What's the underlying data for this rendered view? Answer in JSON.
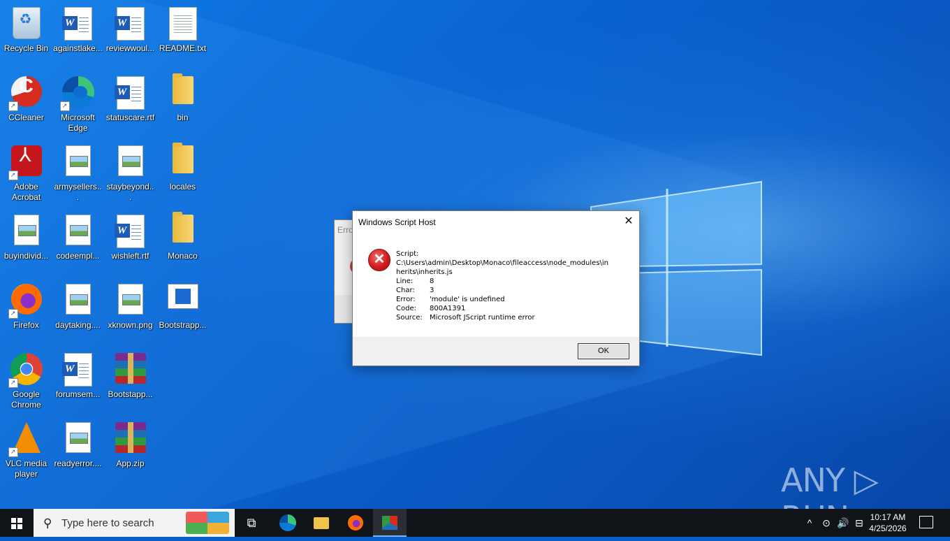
{
  "desktop": {
    "icons": [
      {
        "label": "Recycle Bin",
        "type": "recycle",
        "shortcut": false
      },
      {
        "label": "againstlake...",
        "type": "word",
        "shortcut": false
      },
      {
        "label": "reviewwoul...",
        "type": "word",
        "shortcut": false
      },
      {
        "label": "README.txt",
        "type": "doc",
        "shortcut": false
      },
      {
        "label": "CCleaner",
        "type": "ccleaner",
        "shortcut": true
      },
      {
        "label": "Microsoft Edge",
        "type": "edge",
        "shortcut": true
      },
      {
        "label": "statuscare.rtf",
        "type": "word",
        "shortcut": false
      },
      {
        "label": "bin",
        "type": "folder",
        "shortcut": false
      },
      {
        "label": "Adobe Acrobat",
        "type": "acrobat",
        "shortcut": true
      },
      {
        "label": "armysellers...",
        "type": "img",
        "shortcut": false
      },
      {
        "label": "staybeyond...",
        "type": "img",
        "shortcut": false
      },
      {
        "label": "locales",
        "type": "folder",
        "shortcut": false
      },
      {
        "label": "buyindivid...",
        "type": "img",
        "shortcut": false
      },
      {
        "label": "codeempl...",
        "type": "img",
        "shortcut": false
      },
      {
        "label": "wishleft.rtf",
        "type": "word",
        "shortcut": false
      },
      {
        "label": "Monaco",
        "type": "folder",
        "shortcut": false
      },
      {
        "label": "Firefox",
        "type": "firefox",
        "shortcut": true
      },
      {
        "label": "daytaking....",
        "type": "img",
        "shortcut": false
      },
      {
        "label": "xknown.png",
        "type": "img",
        "shortcut": false
      },
      {
        "label": "Bootstrapp...",
        "type": "bootstrap",
        "shortcut": false
      },
      {
        "label": "Google Chrome",
        "type": "chrome",
        "shortcut": true
      },
      {
        "label": "forumsem...",
        "type": "word",
        "shortcut": false
      },
      {
        "label": "Bootstapp...",
        "type": "rar",
        "shortcut": false
      },
      {
        "label": "VLC media player",
        "type": "vlc",
        "shortcut": true
      },
      {
        "label": "readyerror....",
        "type": "img",
        "shortcut": false
      },
      {
        "label": "App.zip",
        "type": "rar",
        "shortcut": false
      }
    ]
  },
  "background_window": {
    "title": "Erro"
  },
  "dialog": {
    "title": "Windows Script Host",
    "close_glyph": "✕",
    "icon_glyph": "✕",
    "script_label": "Script:",
    "script_path_line1": "C:\\Users\\admin\\Desktop\\Monaco\\fileaccess\\node_modules\\in",
    "script_path_line2": "herits\\inherits.js",
    "fields": [
      {
        "key": "Line:",
        "value": "8"
      },
      {
        "key": "Char:",
        "value": "3"
      },
      {
        "key": "Error:",
        "value": "'module' is undefined"
      },
      {
        "key": "Code:",
        "value": "800A1391"
      },
      {
        "key": "Source:",
        "value": "Microsoft JScript runtime error"
      }
    ],
    "ok_label": "OK"
  },
  "watermark": {
    "text": "ANY ▷ RUN"
  },
  "taskbar": {
    "search_placeholder": "Type here to search",
    "search_glyph": "⚲",
    "taskview_glyph": "⧉",
    "tray_chevron": "^",
    "tray_meet": "⊙",
    "tray_volume": "🔊",
    "tray_network": "⊟",
    "time": "10:17 AM",
    "date": "4/25/2026"
  }
}
